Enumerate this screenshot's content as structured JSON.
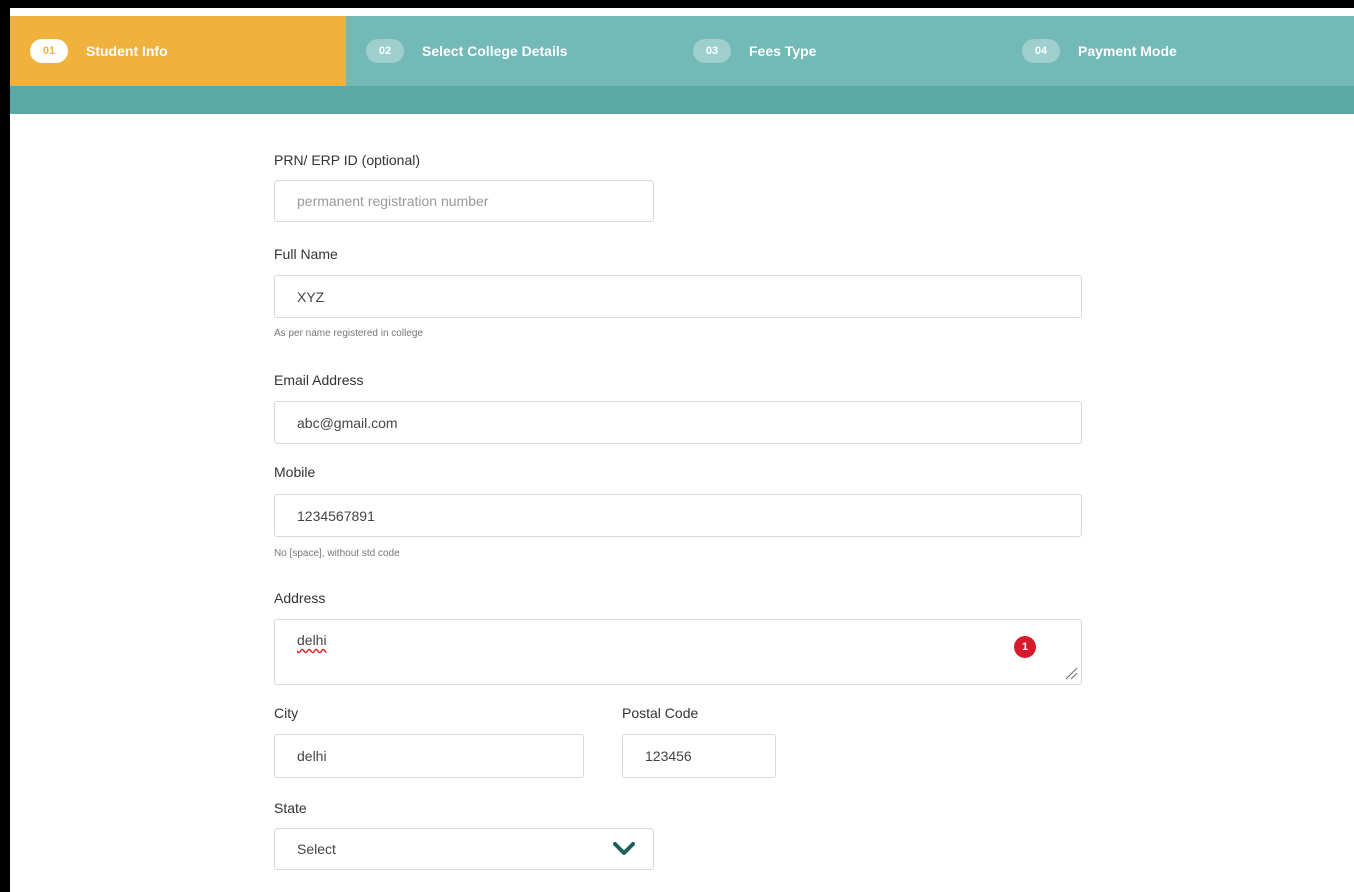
{
  "steps": [
    {
      "num": "01",
      "label": "Student Info"
    },
    {
      "num": "02",
      "label": "Select College Details"
    },
    {
      "num": "03",
      "label": "Fees Type"
    },
    {
      "num": "04",
      "label": "Payment Mode"
    }
  ],
  "form": {
    "prn": {
      "label": "PRN/ ERP ID (optional)",
      "placeholder": "permanent registration number",
      "value": ""
    },
    "full_name": {
      "label": "Full Name",
      "value": "XYZ",
      "hint": "As per name registered in college"
    },
    "email": {
      "label": "Email Address",
      "value": "abc@gmail.com"
    },
    "mobile": {
      "label": "Mobile",
      "value": "1234567891",
      "hint": "No [space], without std code"
    },
    "address": {
      "label": "Address",
      "value": "delhi",
      "badge": "1"
    },
    "city": {
      "label": "City",
      "value": "delhi"
    },
    "postal_code": {
      "label": "Postal Code",
      "value": "123456"
    },
    "state": {
      "label": "State",
      "value": "Select"
    }
  },
  "colors": {
    "active_step": "#f0b23d",
    "stepbar": "#73b9b7",
    "band": "#5aa9a6",
    "badge": "#d81b2c"
  }
}
